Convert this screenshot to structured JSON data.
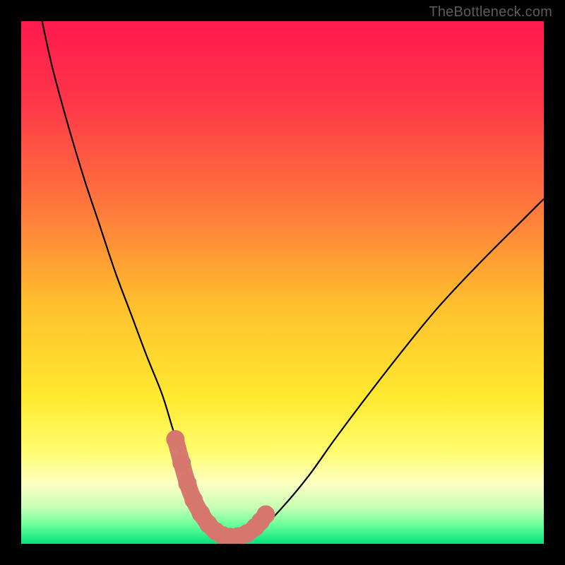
{
  "watermark": "TheBottleneck.com",
  "frame": {
    "inner_x": 30,
    "inner_y": 30,
    "inner_w": 740,
    "inner_h": 740
  },
  "gradient": {
    "type": "vertical",
    "stops": [
      {
        "offset": 0.0,
        "color": "#ff1a4d"
      },
      {
        "offset": 0.15,
        "color": "#ff3549"
      },
      {
        "offset": 0.35,
        "color": "#ff763d"
      },
      {
        "offset": 0.55,
        "color": "#ffc22d"
      },
      {
        "offset": 0.72,
        "color": "#ffe92f"
      },
      {
        "offset": 0.82,
        "color": "#fffc6c"
      },
      {
        "offset": 0.885,
        "color": "#fcffc2"
      },
      {
        "offset": 0.93,
        "color": "#c7ffb5"
      },
      {
        "offset": 0.965,
        "color": "#66ff99"
      },
      {
        "offset": 1.0,
        "color": "#06e27b"
      }
    ]
  },
  "chart_data": {
    "type": "line",
    "title": "",
    "xlabel": "",
    "ylabel": "",
    "xlim": [
      0,
      100
    ],
    "ylim": [
      0,
      100
    ],
    "series": [
      {
        "name": "bottleneck-curve",
        "color": "#000000",
        "x": [
          4,
          6,
          9,
          12,
          15,
          18,
          21,
          24,
          27,
          29,
          31,
          32.5,
          34,
          35.5,
          37,
          38.7,
          40.5,
          43,
          46,
          50,
          55,
          60,
          66,
          73,
          80,
          88,
          96,
          100
        ],
        "y": [
          100,
          91,
          80,
          70,
          61,
          52,
          44,
          36,
          28.5,
          22,
          16,
          11.5,
          8,
          5,
          3,
          1.8,
          1.3,
          1.6,
          3,
          7,
          13,
          20,
          28,
          37,
          45.5,
          54,
          62,
          66
        ]
      },
      {
        "name": "highlight-markers",
        "color": "#d6776e",
        "x": [
          29.5,
          30.7,
          31.8,
          33.0,
          34.4,
          35.8,
          37.2,
          38.6,
          40.0,
          41.5,
          43.2,
          44.8,
          45.8,
          46.8
        ],
        "y": [
          20.0,
          15.5,
          11.6,
          8.4,
          5.8,
          3.8,
          2.4,
          1.6,
          1.3,
          1.4,
          2.0,
          3.2,
          4.3,
          5.6
        ]
      }
    ]
  }
}
